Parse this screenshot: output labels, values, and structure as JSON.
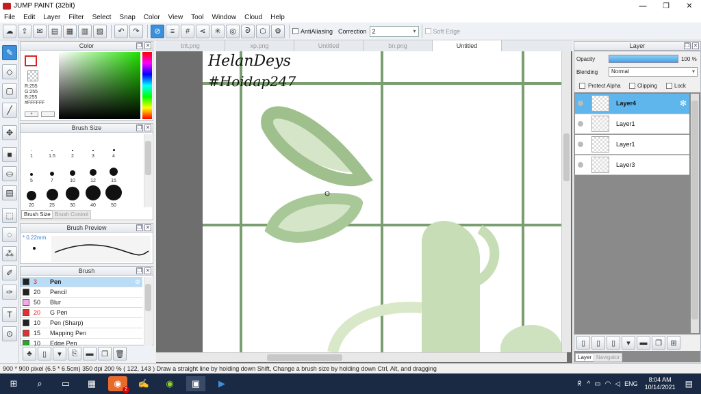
{
  "window": {
    "title": "JUMP PAINT (32bit)",
    "min": "—",
    "max": "❐",
    "close": "✕"
  },
  "menu": [
    "File",
    "Edit",
    "Layer",
    "Filter",
    "Select",
    "Snap",
    "Color",
    "View",
    "Tool",
    "Window",
    "Cloud",
    "Help"
  ],
  "toolbar": {
    "antialiasing_label": "AntiAliasing",
    "correction_label": "Correction",
    "correction_value": "2",
    "softedge_label": "Soft Edge"
  },
  "color_panel": {
    "title": "Color",
    "r": "R:255",
    "g": "G:255",
    "b": "B:255",
    "hex": "#FFFFFF"
  },
  "brush_size_panel": {
    "title": "Brush Size",
    "sizes": [
      "1",
      "1.5",
      "2",
      "3",
      "4",
      "5",
      "7",
      "10",
      "12",
      "15",
      "20",
      "25",
      "30",
      "40",
      "50"
    ],
    "tab_active": "Brush Size",
    "tab_inactive": "Brush Control"
  },
  "brush_preview": {
    "title": "Brush Preview",
    "size": "0.22mm"
  },
  "brush_panel": {
    "title": "Brush",
    "items": [
      {
        "size": "3",
        "name": "Pen",
        "color": "#222222",
        "size_red": true
      },
      {
        "size": "20",
        "name": "Pencil",
        "color": "#222222",
        "size_red": false
      },
      {
        "size": "50",
        "name": "Blur",
        "color": "#f0a8e8",
        "size_red": false
      },
      {
        "size": "20",
        "name": "G Pen",
        "color": "#e03030",
        "size_red": true
      },
      {
        "size": "10",
        "name": "Pen (Sharp)",
        "color": "#222222",
        "size_red": false
      },
      {
        "size": "15",
        "name": "Mapping Pen",
        "color": "#e03030",
        "size_red": false
      },
      {
        "size": "10",
        "name": "Edge Pen",
        "color": "#22aa22",
        "size_red": false
      }
    ]
  },
  "tabs": [
    "btt.png",
    "xp.png",
    "Untitled",
    "bn.png",
    "Untitled"
  ],
  "canvas_text": {
    "line1": "HelanDeys",
    "line2": "#Hoidap247"
  },
  "layer_panel": {
    "title": "Layer",
    "opacity_label": "Opacity",
    "opacity_value": "100 %",
    "opacity_level": 1.0,
    "blending_label": "Blending",
    "blending_value": "Normal",
    "protect_alpha": "Protect Alpha",
    "clipping": "Clipping",
    "lock": "Lock",
    "layers": [
      "Layer4",
      "Layer1",
      "Layer1",
      "Layer3"
    ],
    "tab_active": "Layer",
    "tab_inactive": "Navigator"
  },
  "status": "900 * 900 pixel  (6.5 * 6.5cm)  350 dpi  200 %  ( 122, 143 )  Draw a straight line by holding down Shift, Change a brush size by holding down Ctrl, Alt, and dragging",
  "taskbar": {
    "lang": "ENG",
    "time": "8:04 AM",
    "date": "10/14/2021",
    "badge": "2"
  }
}
